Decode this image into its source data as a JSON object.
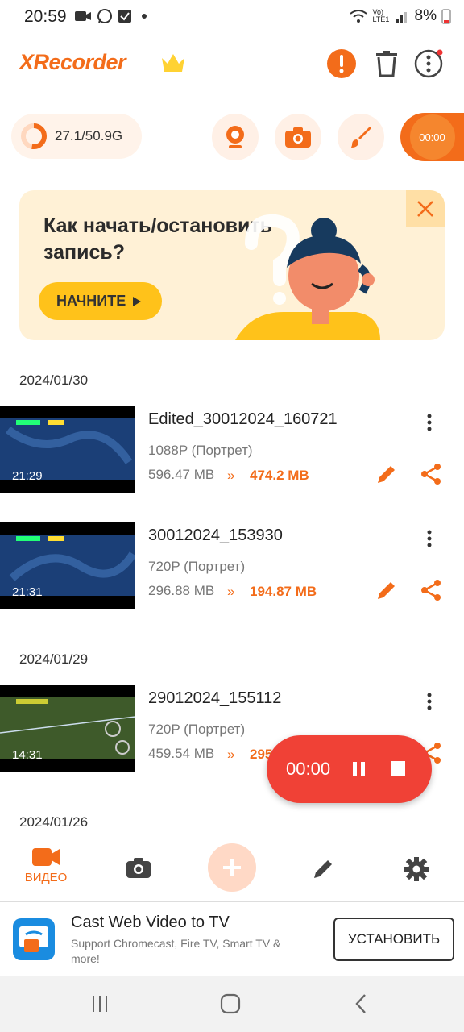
{
  "status_bar": {
    "time": "20:59",
    "battery": "8%",
    "network": "Vo) LTE1"
  },
  "header": {
    "logo": "XRecorder",
    "icons": [
      "crown-icon",
      "alert-icon",
      "trash-icon",
      "more-vert-icon"
    ],
    "accent_color": "#f36c1a"
  },
  "toolbar": {
    "storage": "27.1/50.9G",
    "storage_used_fraction": 0.53,
    "buttons": [
      "webcam-icon",
      "camera-icon",
      "brush-icon"
    ],
    "record_time": "00:00"
  },
  "promo": {
    "title": "Как начать/остановить запись?",
    "button_label": "НАЧНИТЕ"
  },
  "groups": [
    {
      "date": "2024/01/30",
      "videos": [
        {
          "title": "Edited_30012024_160721",
          "resolution": "1088P (Портрет)",
          "size": "596.47 MB",
          "compressed_size": "474.2 MB",
          "duration": "21:29"
        },
        {
          "title": "30012024_153930",
          "resolution": "720P (Портрет)",
          "size": "296.88 MB",
          "compressed_size": "194.87 MB",
          "duration": "21:31"
        }
      ]
    },
    {
      "date": "2024/01/29",
      "videos": [
        {
          "title": "29012024_155112",
          "resolution": "720P (Портрет)",
          "size": "459.54 MB",
          "compressed_size": "295",
          "duration": "14:31"
        }
      ]
    },
    {
      "date": "2024/01/26",
      "videos": []
    }
  ],
  "floating_recorder": {
    "time": "00:00"
  },
  "bottom_nav": {
    "items": [
      {
        "label": "ВИДЕО",
        "icon": "video-icon",
        "active": true
      },
      {
        "label": "",
        "icon": "camera-icon",
        "active": false
      },
      {
        "label": "",
        "icon": "plus-icon",
        "active": false
      },
      {
        "label": "",
        "icon": "pencil-icon",
        "active": false
      },
      {
        "label": "",
        "icon": "gear-icon",
        "active": false
      }
    ]
  },
  "ad": {
    "title": "Cast Web Video to TV",
    "subtitle": "Support Chromecast, Fire TV, Smart TV & more!",
    "button_label": "УСТАНОВИТЬ"
  }
}
